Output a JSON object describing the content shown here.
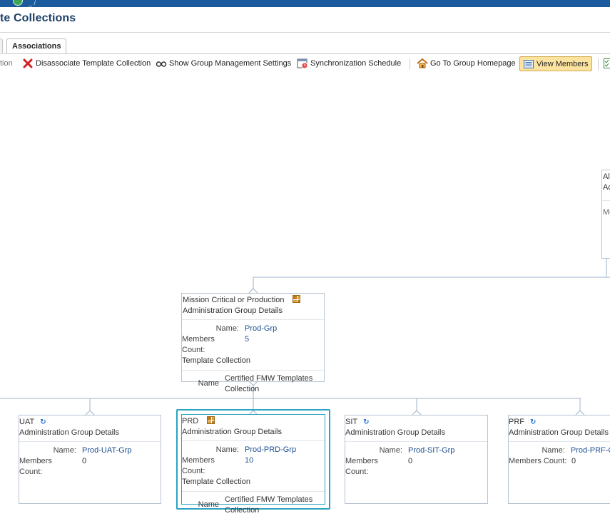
{
  "page": {
    "title": "te Collections",
    "tabs": {
      "active_label": "Associations"
    }
  },
  "toolbar": {
    "cut_item": "tion",
    "disassociate": "Disassociate Template Collection",
    "show_group_mgmt": "Show Group Management Settings",
    "sync_schedule": "Synchronization Schedule",
    "goto_group_home": "Go To Group Homepage",
    "view_members": "View Members"
  },
  "partial_node": {
    "line1": "All",
    "line2": "Ac",
    "line3": "Me"
  },
  "root_node": {
    "title": "Mission Critical or Production",
    "subtitle": "Administration Group Details",
    "name_label": "Name:",
    "name_value": "Prod-Grp",
    "members_label": "Members Count:",
    "members_value": "5",
    "tc_label": "Template Collection",
    "tc_name_label": "Name",
    "tc_name_value_1": "Certified FMW Templates",
    "tc_name_value_2": "Collection"
  },
  "children": [
    {
      "title": "UAT",
      "subtitle": "Administration Group Details",
      "name_label": "Name:",
      "name_value": "Prod-UAT-Grp",
      "members_label": "Members Count:",
      "members_value": "0"
    },
    {
      "title": "PRD",
      "subtitle": "Administration Group Details",
      "name_label": "Name:",
      "name_value": "Prod-PRD-Grp",
      "members_label": "Members Count:",
      "members_value": "10",
      "tc_label": "Template Collection",
      "tc_name_label": "Name",
      "tc_name_value_1": "Certified FMW Templates",
      "tc_name_value_2": "Collection"
    },
    {
      "title": "SIT",
      "subtitle": "Administration Group Details",
      "name_label": "Name:",
      "name_value": "Prod-SIT-Grp",
      "members_label": "Members Count:",
      "members_value": "0"
    },
    {
      "title": "PRF",
      "subtitle": "Administration Group Details",
      "name_label": "Name:",
      "name_value": "Prod-PRF-G",
      "members_label": "Members Count:",
      "members_value": "0"
    }
  ]
}
